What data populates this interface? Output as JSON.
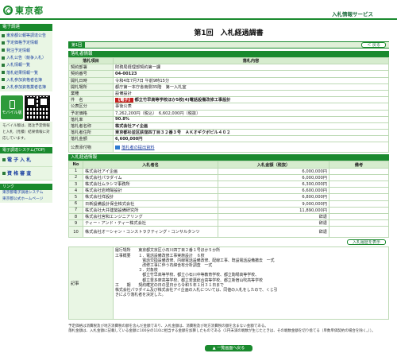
{
  "header": {
    "logo": "東京都",
    "service": "入札情報サービス"
  },
  "sidebar": {
    "menu_title": "電子調達",
    "items": [
      "東京都公報等調達公告",
      "予定価格予定情報",
      "発注予定情報",
      "入札公告（競争入札）",
      "入札情報一覧",
      "落札結果情報一覧",
      "入札参加資格者名簿",
      "入札参加資格業者名簿"
    ],
    "mobile_label": "モバイル版",
    "mobile_note": "モバイル版は、発注予定情報と入札（見積）結果情報に対応しています。",
    "system_bar": "電子調達システム(TOP)",
    "link1": "電 子 入 札",
    "link2": "資 格 審 査",
    "links_title": "リンク",
    "ext1": "東京都電子調達システム",
    "ext2": "東京都公式ホームページ"
  },
  "main": {
    "title": "第1回　入札経過調書",
    "tab": "第1回",
    "back_button": "＜ 戻る",
    "section1": "落札者情報",
    "col_item": "落札項目",
    "col_content": "落札内容",
    "rows": [
      {
        "label": "契約部署",
        "value": "財務局経理部契約第一課"
      },
      {
        "label": "契約番号",
        "value": "04-00123"
      },
      {
        "label": "開札日時",
        "value": "令和4年7月7日 午前9時15分"
      },
      {
        "label": "開札場所",
        "value": "都庁第一本庁舎南側35階　第一入札室"
      },
      {
        "label": "業種",
        "value": "設備設計"
      }
    ],
    "subject_label": "件　名",
    "subject_tag": "【電子】",
    "subject": "都立竹早高等学校ほか5校(4)電話設備改修工事設計",
    "rows2": [
      {
        "label": "公表区分",
        "value": "事後公表"
      },
      {
        "label": "予定価格",
        "value": "7,262,200円（税込）　6,602,000円（税抜）"
      },
      {
        "label": "落札率",
        "value": "90.8%"
      },
      {
        "label": "落札者名称",
        "value": "株式会社アイ企画"
      },
      {
        "label": "落札者住所",
        "value": "東京都杉並区荻窪四丁目３２番３号　ＡＫオギクボビル４０２"
      },
      {
        "label": "落札金額",
        "value": "6,600,000円"
      },
      {
        "label": "公表添付物",
        "value": "落札者の提出資料"
      }
    ],
    "section2": "入札経過情報",
    "bid_headers": {
      "no": "No",
      "name": "入札者名",
      "amount": "入札金額（税抜）",
      "remark": "備考"
    },
    "bids": [
      {
        "no": "1",
        "name": "株式会社アイ企画",
        "amount": "6,000,000円",
        "remark": ""
      },
      {
        "no": "2",
        "name": "株式会社パラダイム",
        "amount": "6,000,000円",
        "remark": ""
      },
      {
        "no": "3",
        "name": "株式会社ムラシマ事務所",
        "amount": "6,300,000円",
        "remark": ""
      },
      {
        "no": "4",
        "name": "株式会社岩崎陽設計",
        "amount": "6,600,000円",
        "remark": ""
      },
      {
        "no": "5",
        "name": "株式会社祥設計",
        "amount": "6,800,000円",
        "remark": ""
      },
      {
        "no": "6",
        "name": "日新設備設計保全株式会社",
        "amount": "9,000,000円",
        "remark": ""
      },
      {
        "no": "7",
        "name": "株式会社大井建築設備研究所",
        "amount": "11,890,000円",
        "remark": ""
      },
      {
        "no": "8",
        "name": "株式会社宮和エンジニアリング",
        "amount": "辞退",
        "remark": ""
      },
      {
        "no": "9",
        "name": "ティー・アンド・ティー株式会社",
        "amount": "辞退",
        "remark": ""
      },
      {
        "no": "10",
        "name": "株式会社オーシャン・コンストラクティング・コンサルタンツ",
        "amount": "辞退",
        "remark": ""
      }
    ],
    "history_button": "入札履歴を表示",
    "note_label": "記事",
    "note_text": "履行場所　　東京都文京区小石川四丁目２番１号ほか５か所\n工事概要　　１．電話設備改修工事実施設計　６校\n　　　　　　　電話交換設備改修、内線電話設備改修、配線工事、既設電話設備撤去　一式\n　　　　　　　改修工事に伴う石綿含有分析調査　一式\n　　　　　　２．対象校\n　　　　　　　都立竹早高等学校、都立小石川中等教育学校、都立駒場高等学校、\n　　　　　　　都立豊多摩高等学校、都立若葉総合高等学校、都立新宿山吹高等学校\n工　　期　　契約確定の日の翌日から令和５年１月３１日まで\n株式会社パラダイム及び株式会社アイ企画の入札については、同値の入札をしたので、くじ引\nきにより落札者を決定した。",
    "footnote": "予定価格は消費税及び地方消費税の額を含んだ金額であり、入札金額は、消費税及び地方消費税の額を含まない金額である。\n落札金額は、入札金額に記載している金額に100分の110に相当する金額を加算したものである（1円未満の端数が生じたときは、その端数金額を切り捨てる（単数単価契約の場合を除く。））。",
    "top_button": "▲ 一覧画面へ戻る"
  }
}
